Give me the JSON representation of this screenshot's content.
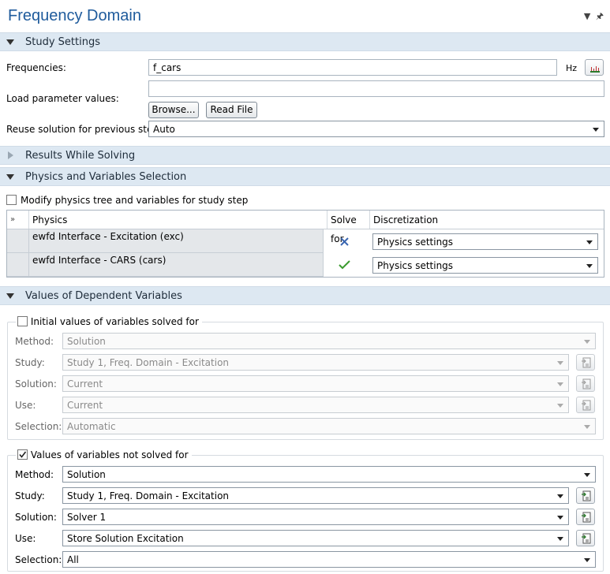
{
  "title": "Frequency Domain",
  "sections": {
    "study_settings": "Study Settings",
    "results_while_solving": "Results While Solving",
    "physics_selection": "Physics and Variables Selection",
    "dependent_values": "Values of Dependent Variables"
  },
  "study": {
    "frequencies_label": "Frequencies:",
    "frequencies_value": "f_cars",
    "unit": "Hz",
    "load_label": "Load parameter values:",
    "load_value": "",
    "browse": "Browse...",
    "read_file": "Read File",
    "reuse_label": "Reuse solution for previous step:",
    "reuse_value": "Auto"
  },
  "physics": {
    "modify_label": "Modify physics tree and variables for study step",
    "columns": [
      "Physics",
      "Solve for",
      "Discretization"
    ],
    "rows": [
      {
        "name": "ewfd Interface - Excitation (exc)",
        "solve": "cross",
        "discretization": "Physics settings"
      },
      {
        "name": "ewfd Interface - CARS (cars)",
        "solve": "check",
        "discretization": "Physics settings"
      }
    ]
  },
  "initial": {
    "legend": "Initial values of variables solved for",
    "checked": false,
    "labels": [
      "Method:",
      "Study:",
      "Solution:",
      "Use:",
      "Selection:"
    ],
    "values": [
      "Solution",
      "Study 1, Freq. Domain - Excitation",
      "Current",
      "Current",
      "Automatic"
    ]
  },
  "notsolved": {
    "legend": "Values of variables not solved for",
    "checked": true,
    "labels": [
      "Method:",
      "Study:",
      "Solution:",
      "Use:",
      "Selection:"
    ],
    "values": [
      "Solution",
      "Study 1, Freq. Domain - Excitation",
      "Solver 1",
      "Store Solution Excitation",
      "All"
    ]
  },
  "colors": {
    "title": "#1f5b9c",
    "header_bg": "#dde8f2",
    "check": "#3a9a2e",
    "cross": "#3a66b0"
  }
}
